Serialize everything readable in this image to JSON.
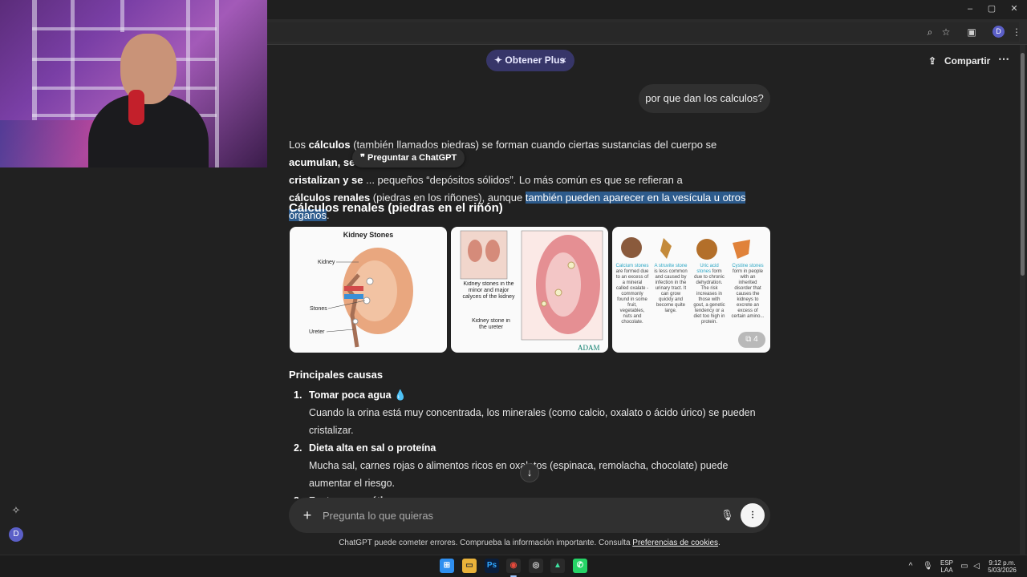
{
  "browser": {
    "window_controls": {
      "minimize": "–",
      "maximize": "▢",
      "close": "✕"
    },
    "profile_initial": "D",
    "icons": [
      "zoom-icon",
      "star-icon",
      "extensions-icon",
      "profile-avatar"
    ]
  },
  "header": {
    "plus_label": "Obtener Plus",
    "plus_icon": "✦",
    "plus_close": "×",
    "share_label": "Compartir",
    "more_label": "⋯"
  },
  "sidebar": {
    "avatar_initial": "D"
  },
  "chat": {
    "user_message": "por que dan los calculos?",
    "ask_chatgpt_label": "Preguntar a ChatGPT",
    "answer": {
      "p1_bold1": "cálculos",
      "p1_text1": "Los ",
      "p1_text2": " (también llamados piedras) se forman cuando ciertas sustancias del cuerpo se ",
      "p1_bold2": "acumulan, se",
      "p1_bold3": "cristalizan y se",
      "p1_text3": " ... pequeños “depósitos sólidos”. Lo más común es que se refieran a",
      "p1_bold4": "cálculos renales",
      "p1_text4": " (piedras en los riñones), aunque ",
      "p1_highlight": "también pueden aparecer en la vesícula u otros órganos",
      "p1_text5": "."
    },
    "section_kidney_title": "Cálculos renales (piedras en el riñón)",
    "images": {
      "img1_title": "Kidney Stones",
      "img1_labels": [
        "Kidney",
        "Stones",
        "Ureter"
      ],
      "img2_label1": "Kidney stones in the minor and major calyces of the kidney",
      "img2_label2": "Kidney stone in the ureter",
      "img2_brand": "ADAM",
      "img3_types": [
        {
          "name": "Calcium stones",
          "desc": "are formed due to an excess of a mineral called oxalate - commonly found in some fruit, vegetables, nuts and chocolate."
        },
        {
          "name": "A struvite stone",
          "desc": "is less common and caused by infection in the urinary tract. It can grow quickly and become quite large."
        },
        {
          "name": "Uric acid stones",
          "desc": "form due to chronic dehydration. The risk increases in those with gout, a genetic tendency or a diet too high in protein."
        },
        {
          "name": "Cystine stones",
          "desc": "form in people with an inherited disorder that causes the kidneys to excrete an excess of certain amino..."
        }
      ],
      "more_count": "4"
    },
    "section_causes_title": "Principales causas",
    "causes": [
      {
        "num": "1.",
        "title": "Tomar poca agua 💧",
        "body": "Cuando la orina está muy concentrada, los minerales (como calcio, oxalato o ácido úrico) se pueden cristalizar."
      },
      {
        "num": "2.",
        "title": "Dieta alta en sal o proteína",
        "body": "Mucha sal, carnes rojas o alimentos ricos en oxalatos (espinaca, remolacha, chocolate) puede aumentar el riesgo."
      },
      {
        "num": "3.",
        "title": "Factores genéticos",
        "body": ""
      }
    ]
  },
  "composer": {
    "placeholder": "Pregunta lo que quieras",
    "disclaimer": "ChatGPT puede cometer errores. Comprueba la información importante. Consulta ",
    "disclaimer_link": "Preferencias de cookies",
    "disclaimer_end": "."
  },
  "taskbar": {
    "apps": [
      "windows-start",
      "file-explorer",
      "photoshop",
      "chrome",
      "obs",
      "streamlabs",
      "whatsapp"
    ],
    "lang_line1": "ESP",
    "lang_line2": "LAA",
    "time": "9:12 p.m.",
    "date": "5/03/2026"
  }
}
